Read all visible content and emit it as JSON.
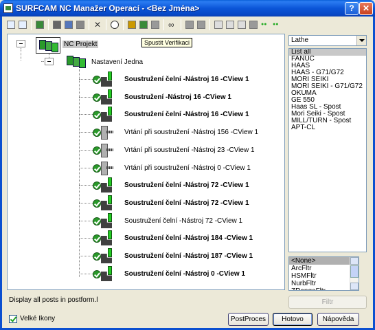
{
  "window": {
    "title": "SURFCAM NC Manažer Operací - <Bez Jména>",
    "help_label": "?",
    "close_label": "✕"
  },
  "toolbar": {
    "icons": [
      "expand-icon",
      "collapse-icon",
      "copy-op-icon",
      "cut-icon",
      "copy-icon",
      "paste-icon",
      "delete-icon",
      "clock-icon",
      "verify-icon",
      "save-icon",
      "tool-icon",
      "glasses-icon",
      "arrow-down-icon",
      "edit-icon",
      "page-icon",
      "page-edit-icon",
      "page-check-icon",
      "pen-icon",
      "dots-green-icon",
      "dots-green2-icon"
    ]
  },
  "tooltip": "Spustit Verifikaci",
  "tree": {
    "root_label": "NC Projekt",
    "setup_label": "Nastavení Jedna",
    "operations": [
      {
        "label": "Soustružení čelní  -Nástroj 16 -CView 1",
        "bold": true,
        "kind": "turn"
      },
      {
        "label": "Soustružení   -Nástroj 16 -CView 1",
        "bold": true,
        "kind": "turn"
      },
      {
        "label": "Soustružení čelní  -Nástroj 16 -CView 1",
        "bold": true,
        "kind": "turn"
      },
      {
        "label": "Vrtání při soustružení  -Nástroj 156 -CView 1",
        "bold": false,
        "kind": "drill"
      },
      {
        "label": "Vrtání při soustružení  -Nástroj 23 -CView 1",
        "bold": false,
        "kind": "drill"
      },
      {
        "label": "Vrtání při soustružení  -Nástroj 0 -CView 1",
        "bold": false,
        "kind": "drill"
      },
      {
        "label": "Soustružení čelní  -Nástroj 72 -CView 1",
        "bold": true,
        "kind": "turn"
      },
      {
        "label": "Soustružení čelní  -Nástroj 72 -CView 1",
        "bold": true,
        "kind": "turn"
      },
      {
        "label": "Soustružení čelní  -Nástroj 72 -CView 1",
        "bold": false,
        "kind": "turn"
      },
      {
        "label": "Soustružení čelní  -Nástroj 184 -CView 1",
        "bold": true,
        "kind": "turn"
      },
      {
        "label": "Soustružení čelní  -Nástroj 187 -CView 1",
        "bold": true,
        "kind": "turn"
      },
      {
        "label": "Soustružení čelní  -Nástroj 0 -CView 1",
        "bold": true,
        "kind": "turn"
      }
    ]
  },
  "machine_select": {
    "value": "Lathe"
  },
  "post_list": {
    "items": [
      "List all",
      "FANUC",
      "HAAS",
      "HAAS - G71/G72",
      "MORI SEIKI",
      "MORI SEIKI - G71/G72",
      "OKUMA",
      "GE 550",
      "Haas SL - Spost",
      "Mori Seiki - Spost",
      "MILL/TURN - Spost",
      "APT-CL"
    ],
    "selected_index": 0
  },
  "filter_list": {
    "items": [
      "<None>",
      "ArcFltr",
      "HSMFltr",
      "NurbFltr",
      "ZRangeFltr"
    ],
    "selected_index": 0
  },
  "buttons": {
    "filter": "Filtr",
    "postproces": "PostProces",
    "ok": "Hotovo",
    "help": "Nápověda"
  },
  "status_text": "Display all posts in postform.l",
  "large_icons": {
    "label": "Velké Ikony",
    "checked": true
  }
}
